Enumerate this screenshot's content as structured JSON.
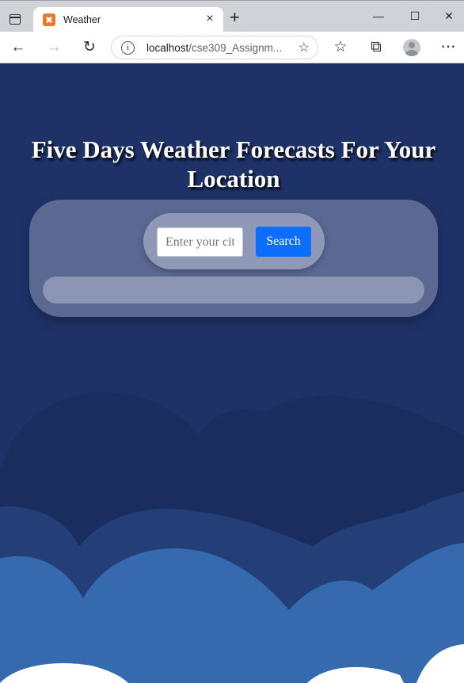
{
  "browser": {
    "tab_title": "Weather",
    "favicon_glyph": "✖",
    "address_host": "localhost",
    "address_path": "/cse309_Assignm...",
    "icons": {
      "window": "window-icon",
      "close_tab": "×",
      "new_tab": "+",
      "minimize": "—",
      "maximize": "☐",
      "close_window": "✕",
      "back": "←",
      "forward": "→",
      "refresh": "↻",
      "info": "i",
      "add_favorite": "☆",
      "favorites": "☆",
      "collections": "⧉",
      "menu": "⋯"
    }
  },
  "page": {
    "title": "Five Days Weather Forecasts For Your Location",
    "search": {
      "placeholder": "Enter your city",
      "button_label": "Search"
    },
    "colors": {
      "background": "#1f3268",
      "button": "#0b6efd"
    }
  }
}
